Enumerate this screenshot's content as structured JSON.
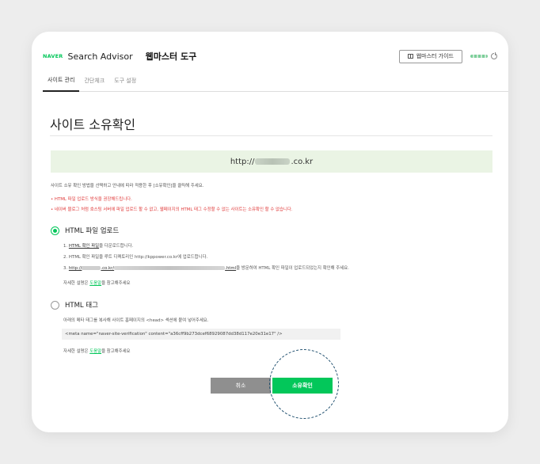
{
  "header": {
    "logo": "NAVER",
    "app_name": "Search Advisor",
    "page_name": "웹마스터 도구",
    "guide_button": "웹마스터 가이드"
  },
  "nav": {
    "items": [
      {
        "label": "사이트 관리"
      },
      {
        "label": "간단체크"
      },
      {
        "label": "도구 설정"
      }
    ]
  },
  "main": {
    "title": "사이트 소유확인",
    "url_prefix": "http://",
    "url_suffix": ".co.kr",
    "description": "사이트 소유 확인 방법을 선택하고 안내에 따라 적용한 후 [소유확인]을 클릭해 주세요.",
    "warnings": [
      "• HTML 파일 업로드 방식을 권장해드립니다.",
      "• 네이버 블로그 처럼 호스팅 서버에 파일 업로드 할 수 없고, 웹페이지의 HTML 태그 수정할 수 없는 사이트는 소유확인 할 수 없습니다."
    ],
    "option_file": {
      "label": "HTML 파일 업로드",
      "step1_prefix": "1. ",
      "step1_link": "HTML 확인 파일",
      "step1_suffix": "을 다운로드합니다.",
      "step2": "2. HTML 확인 파일을 루트 디렉토리인 http://kppower.co.kr에 업로드합니다.",
      "step3_prefix": "3. ",
      "step3_link_start": "http://",
      "step3_link_mid": ".co.kr/",
      "step3_link_end": ".html",
      "step3_suffix": "을 방문하여 HTML 확인 파일이 업로드되었는지 확인해 주세요.",
      "help_prefix": "자세한 설명은 ",
      "help_link": "도움말",
      "help_suffix": "을 참고해주세요"
    },
    "option_tag": {
      "label": "HTML 태그",
      "instruction": "아래의 메타 태그를 복사해 사이트 홈페이지의 <head> 섹션에 붙여 넣어주세요.",
      "meta_tag": "<meta name=\"naver-site-verification\" content=\"a36cff9b273dcef68929087dd38d117e20e31e17\" />",
      "help_prefix": "자세한 설명은 ",
      "help_link": "도움말",
      "help_suffix": "을 참고해주세요"
    },
    "cancel_button": "취소",
    "confirm_button": "소유확인"
  },
  "colors": {
    "accent": "#03c75a",
    "warning": "#e03b3b",
    "banner_bg": "#eaf4e4",
    "cancel_bg": "#8f8f8f"
  }
}
